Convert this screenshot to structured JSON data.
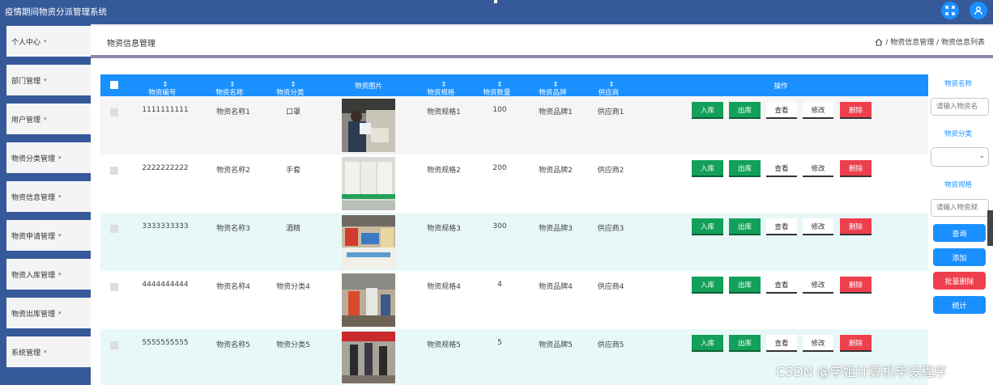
{
  "app": {
    "title": "疫情期间物资分派管理系统"
  },
  "sidebar": {
    "items": [
      {
        "label": "个人中心"
      },
      {
        "label": "部门管理"
      },
      {
        "label": "用户管理"
      },
      {
        "label": "物资分类管理"
      },
      {
        "label": "物资信息管理"
      },
      {
        "label": "物资申请管理"
      },
      {
        "label": "物资入库管理"
      },
      {
        "label": "物资出库管理"
      },
      {
        "label": "系统管理"
      }
    ]
  },
  "page": {
    "title": "物资信息管理",
    "breadcrumb": "/ 物资信息管理 / 物资信息列表"
  },
  "table": {
    "columns": [
      "物资编号",
      "物资名称",
      "物资分类",
      "物资图片",
      "物资规格",
      "物资数量",
      "物资品牌",
      "供应商",
      "操作"
    ],
    "rows": [
      {
        "code": "1111111111",
        "name": "物资名称1",
        "category": "口罩",
        "spec": "物资规格1",
        "qty": "100",
        "brand": "物资品牌1",
        "supplier": "供应商1"
      },
      {
        "code": "2222222222",
        "name": "物资名称2",
        "category": "手套",
        "spec": "物资规格2",
        "qty": "200",
        "brand": "物资品牌2",
        "supplier": "供应商2"
      },
      {
        "code": "3333333333",
        "name": "物资名称3",
        "category": "酒精",
        "spec": "物资规格3",
        "qty": "300",
        "brand": "物资品牌3",
        "supplier": "供应商3"
      },
      {
        "code": "4444444444",
        "name": "物资名称4",
        "category": "物资分类4",
        "spec": "物资规格4",
        "qty": "4",
        "brand": "物资品牌4",
        "supplier": "供应商4"
      },
      {
        "code": "5555555555",
        "name": "物资名称5",
        "category": "物资分类5",
        "spec": "物资规格5",
        "qty": "5",
        "brand": "物资品牌5",
        "supplier": "供应商5"
      }
    ],
    "actions": {
      "in": "入库",
      "out": "出库",
      "view": "查看",
      "edit": "修改",
      "delete": "删除"
    }
  },
  "search": {
    "name_label": "物资名称",
    "name_placeholder": "请输入物资名",
    "category_label": "物资分类",
    "spec_label": "物资规格",
    "spec_placeholder": "请输入物资规",
    "buttons": {
      "query": "查询",
      "add": "添加",
      "batch_delete": "批量删除",
      "stats": "统计"
    }
  },
  "watermark": "CSDN @学姐计算机毕设程序",
  "colors": {
    "topbar": "#36599a",
    "header": "#1a90ff",
    "green": "#13a05a",
    "red": "#ee3f4d",
    "row_alt": "#e8f8f8"
  }
}
